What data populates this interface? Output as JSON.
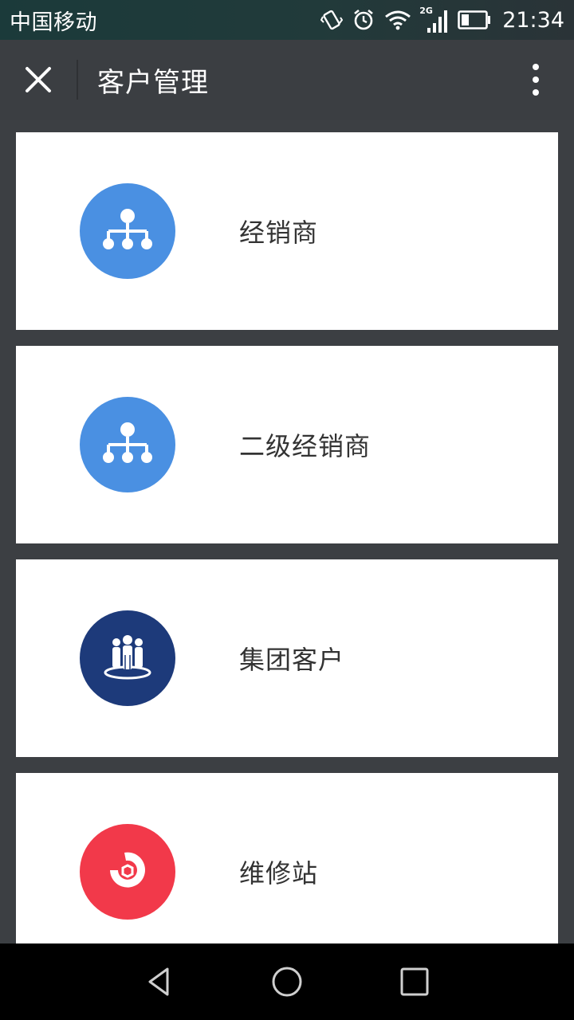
{
  "status_bar": {
    "carrier": "中国移动",
    "network_label": "2G",
    "time": "21:34",
    "icons": [
      "vibrate-icon",
      "alarm-icon",
      "wifi-icon",
      "signal-icon",
      "battery-icon"
    ]
  },
  "app_bar": {
    "title": "客户管理",
    "close_icon": "close-icon",
    "more_icon": "more-vert-icon"
  },
  "cards": [
    {
      "label": "经销商",
      "icon": "org-tree-icon",
      "color": "#4a90e2"
    },
    {
      "label": "二级经销商",
      "icon": "org-tree-icon",
      "color": "#4a90e2"
    },
    {
      "label": "集团客户",
      "icon": "group-people-icon",
      "color": "#1d3a7a"
    },
    {
      "label": "维修站",
      "icon": "wrench-socket-icon",
      "color": "#f2394a"
    }
  ],
  "nav_bar": {
    "icons": [
      "back-icon",
      "home-icon",
      "recents-icon"
    ]
  },
  "colors": {
    "background": "#3c3f43",
    "app_bar": "#3b3e42",
    "card": "#ffffff",
    "text": "#333333"
  }
}
